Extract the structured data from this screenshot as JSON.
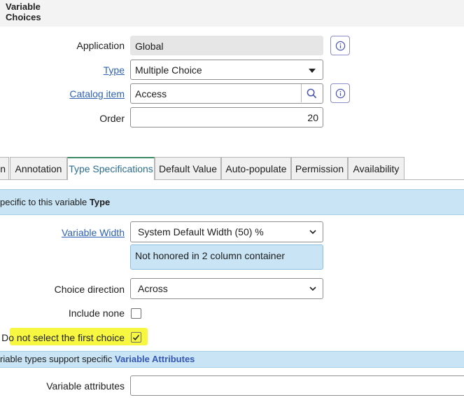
{
  "header": {
    "title_line1": "Variable",
    "title_line2": "Choices"
  },
  "form": {
    "application": {
      "label": "Application",
      "value": "Global"
    },
    "type": {
      "label": "Type",
      "value": "Multiple Choice"
    },
    "catalog_item": {
      "label": "Catalog item",
      "value": "Access"
    },
    "order": {
      "label": "Order",
      "value": "20"
    }
  },
  "tabs": [
    {
      "label": "n"
    },
    {
      "label": "Annotation"
    },
    {
      "label": "Type Specifications"
    },
    {
      "label": "Default Value"
    },
    {
      "label": "Auto-populate"
    },
    {
      "label": "Permission"
    },
    {
      "label": "Availability"
    }
  ],
  "type_section": {
    "band_prefix": "pecific to this variable ",
    "band_bold": "Type",
    "variable_width": {
      "label": "Variable Width",
      "value": "System Default Width (50) %"
    },
    "note": "Not honored in 2 column container",
    "choice_direction": {
      "label": "Choice direction",
      "value": "Across"
    },
    "include_none": {
      "label": "Include none",
      "checked": false
    },
    "first_choice": {
      "label": "Do not select the first choice",
      "checked": true
    }
  },
  "attributes_section": {
    "band_prefix": "riable types support specific ",
    "band_link": "Variable Attributes",
    "variable_attributes": {
      "label": "Variable attributes",
      "value": ""
    }
  },
  "colors": {
    "link": "#2f62b4",
    "band": "#c9e4f4",
    "highlight": "#f7f742",
    "active_tab_border": "#3b8a63"
  }
}
